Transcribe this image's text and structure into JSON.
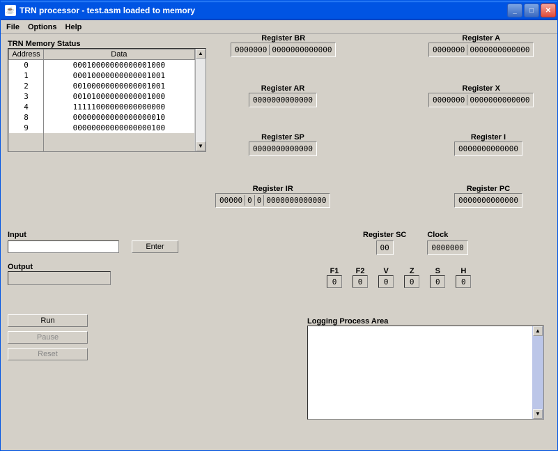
{
  "window": {
    "title": "TRN processor - test.asm loaded to memory"
  },
  "menu": {
    "file": "File",
    "options": "Options",
    "help": "Help"
  },
  "memory": {
    "title": "TRN Memory Status",
    "col_address": "Address",
    "col_data": "Data",
    "rows": [
      {
        "addr": "0",
        "data": "00010000000000001000"
      },
      {
        "addr": "1",
        "data": "00010000000000001001"
      },
      {
        "addr": "2",
        "data": "00100000000000001001"
      },
      {
        "addr": "3",
        "data": "00101000000000001000"
      },
      {
        "addr": "4",
        "data": "11111000000000000000"
      },
      {
        "addr": "8",
        "data": "00000000000000000010"
      },
      {
        "addr": "9",
        "data": "00000000000000000100"
      }
    ]
  },
  "registers": {
    "br": {
      "label": "Register BR",
      "parts": [
        "0000000",
        "0000000000000"
      ]
    },
    "a": {
      "label": "Register A",
      "parts": [
        "0000000",
        "0000000000000"
      ]
    },
    "ar": {
      "label": "Register AR",
      "parts": [
        "0000000000000"
      ]
    },
    "x": {
      "label": "Register X",
      "parts": [
        "0000000",
        "0000000000000"
      ]
    },
    "sp": {
      "label": "Register SP",
      "parts": [
        "0000000000000"
      ]
    },
    "i": {
      "label": "Register I",
      "parts": [
        "0000000000000"
      ]
    },
    "ir": {
      "label": "Register IR",
      "parts": [
        "00000",
        "0",
        "0",
        "0000000000000"
      ]
    },
    "pc": {
      "label": "Register PC",
      "parts": [
        "0000000000000"
      ]
    },
    "sc": {
      "label": "Register SC",
      "value": "00"
    },
    "clock": {
      "label": "Clock",
      "value": "0000000"
    }
  },
  "flags": {
    "f1": {
      "label": "F1",
      "value": "0"
    },
    "f2": {
      "label": "F2",
      "value": "0"
    },
    "v": {
      "label": "V",
      "value": "0"
    },
    "z": {
      "label": "Z",
      "value": "0"
    },
    "s": {
      "label": "S",
      "value": "0"
    },
    "h": {
      "label": "H",
      "value": "0"
    }
  },
  "io": {
    "input_label": "Input",
    "enter_label": "Enter",
    "output_label": "Output"
  },
  "controls": {
    "run": "Run",
    "pause": "Pause",
    "reset": "Reset"
  },
  "log": {
    "label": "Logging Process Area"
  }
}
